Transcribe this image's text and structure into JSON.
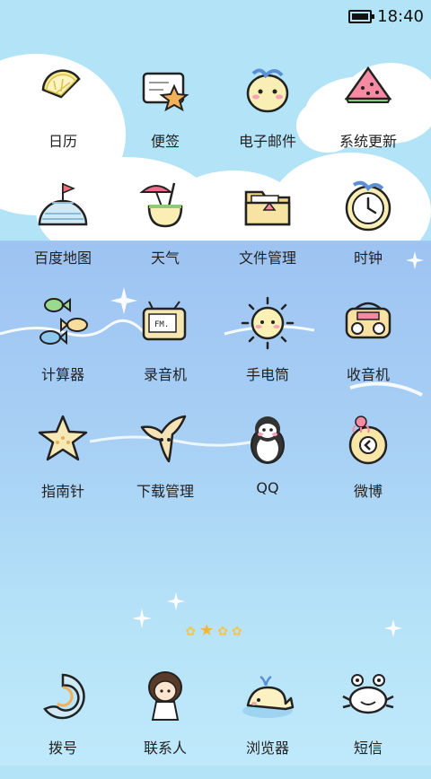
{
  "status": {
    "time": "18:40"
  },
  "apps": [
    {
      "label": "日历",
      "icon": "lemon-slice-icon"
    },
    {
      "label": "便签",
      "icon": "starfish-note-icon"
    },
    {
      "label": "电子邮件",
      "icon": "seal-icon"
    },
    {
      "label": "系统更新",
      "icon": "watermelon-icon"
    },
    {
      "label": "百度地图",
      "icon": "igloo-icon"
    },
    {
      "label": "天气",
      "icon": "coconut-drink-icon"
    },
    {
      "label": "文件管理",
      "icon": "folder-icon"
    },
    {
      "label": "时钟",
      "icon": "clock-icon"
    },
    {
      "label": "计算器",
      "icon": "fish-icon"
    },
    {
      "label": "录音机",
      "icon": "radio-fm-icon"
    },
    {
      "label": "手电筒",
      "icon": "sun-icon"
    },
    {
      "label": "收音机",
      "icon": "boombox-icon"
    },
    {
      "label": "指南针",
      "icon": "starfish-icon"
    },
    {
      "label": "下载管理",
      "icon": "manta-ray-icon"
    },
    {
      "label": "QQ",
      "icon": "penguin-icon"
    },
    {
      "label": "微博",
      "icon": "shell-icon"
    }
  ],
  "dock": [
    {
      "label": "拨号",
      "icon": "spiral-shell-icon"
    },
    {
      "label": "联系人",
      "icon": "girl-icon"
    },
    {
      "label": "浏览器",
      "icon": "whale-icon"
    },
    {
      "label": "短信",
      "icon": "crab-icon"
    }
  ],
  "pager": {
    "pages": 4,
    "current": 2
  }
}
